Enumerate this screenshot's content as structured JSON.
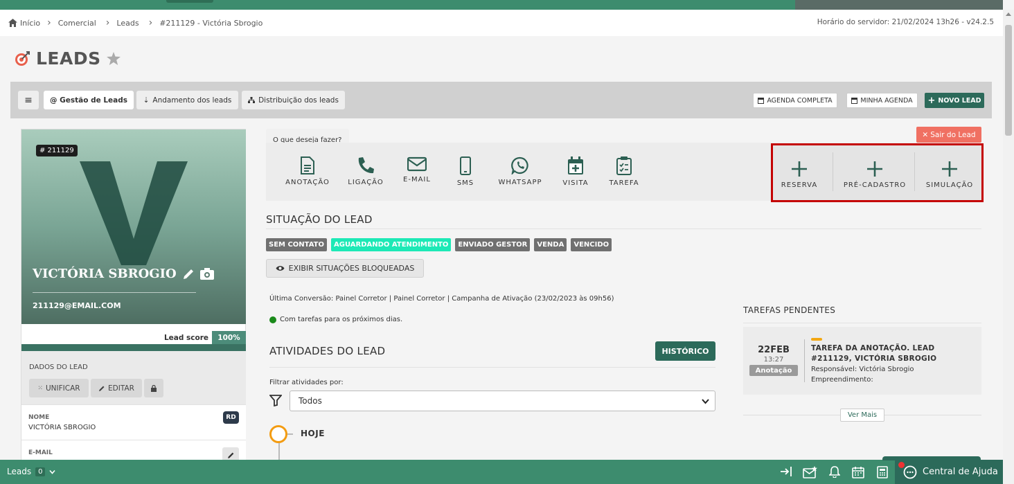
{
  "breadcrumb": {
    "home": "Início",
    "items": [
      "Comercial",
      "Leads",
      "#211129 - Victória Sbrogio"
    ],
    "server_time": "Horário do servidor: 21/02/2024 13h26 - v24.2.5"
  },
  "page": {
    "title": "LEADS"
  },
  "toolbar": {
    "menu_icon": "≡",
    "tabs": [
      "@ Gestão de Leads",
      "Andamento dos leads",
      "Distribuição dos leads"
    ],
    "agenda_completa": "AGENDA COMPLETA",
    "minha_agenda": "MINHA AGENDA",
    "novo_lead": "NOVO LEAD"
  },
  "lead": {
    "id": "# 211129",
    "initial": "V",
    "name": "VICTÓRIA SBROGIO",
    "email": "211129@EMAIL.COM",
    "score_label": "Lead score",
    "score_value": "100%",
    "score_fraction": 1.0
  },
  "dados": {
    "label": "DADOS DO LEAD",
    "unificar": "UNIFICAR",
    "editar": "EDITAR",
    "fields": [
      {
        "key": "NOME",
        "value": "VICTÓRIA SBROGIO",
        "badge": "RD"
      },
      {
        "key": "E-MAIL",
        "value": ""
      }
    ]
  },
  "actions": {
    "heading": "O que deseja fazer?",
    "items": [
      "ANOTAÇÃO",
      "LIGAÇÃO",
      "E-MAIL",
      "SMS",
      "WHATSAPP",
      "VISITA",
      "TAREFA"
    ],
    "boxed": [
      "RESERVA",
      "PRÉ-CADASTRO",
      "SIMULAÇÃO"
    ],
    "sair": "Sair do Lead"
  },
  "situacao": {
    "title": "SITUAÇÃO DO LEAD",
    "tags": [
      "SEM CONTATO",
      "AGUARDANDO ATENDIMENTO",
      "ENVIADO GESTOR",
      "VENDA",
      "VENCIDO"
    ],
    "active_tag": "AGUARDANDO ATENDIMENTO",
    "blocked_btn": "EXIBIR SITUAÇÕES BLOQUEADAS",
    "conversion": "Última Conversão: Painel Corretor | Painel Corretor | Campanha de Ativação (23/02/2023 às 09h56)",
    "tasks_note": "Com tarefas para os próximos dias."
  },
  "atividades": {
    "title": "ATIVIDADES DO LEAD",
    "historico": "HISTÓRICO",
    "filter_label": "Filtrar atividades por:",
    "filter_value": "Todos",
    "timeline_label": "HOJE"
  },
  "pending": {
    "title": "TAREFAS PENDENTES",
    "task": {
      "day": "22FEB",
      "time": "13:27",
      "badge": "Anotação",
      "title": "TAREFA DA ANOTAÇÃO. LEAD #211129, VICTÓRIA SBROGIO",
      "responsavel": "Responsável: Victória Sbrogio",
      "empreendimento": "Empreendimento:"
    },
    "ver_mais": "Ver Mais"
  },
  "footer": {
    "leads": "Leads",
    "count": "0",
    "help": "Central de Ajuda"
  },
  "colors": {
    "brand_green": "#3d8c6e",
    "dark_green": "#2c6a5a",
    "active_tag": "#1de9b6",
    "highlight_box": "#c40000",
    "sair_button": "#f07062"
  }
}
